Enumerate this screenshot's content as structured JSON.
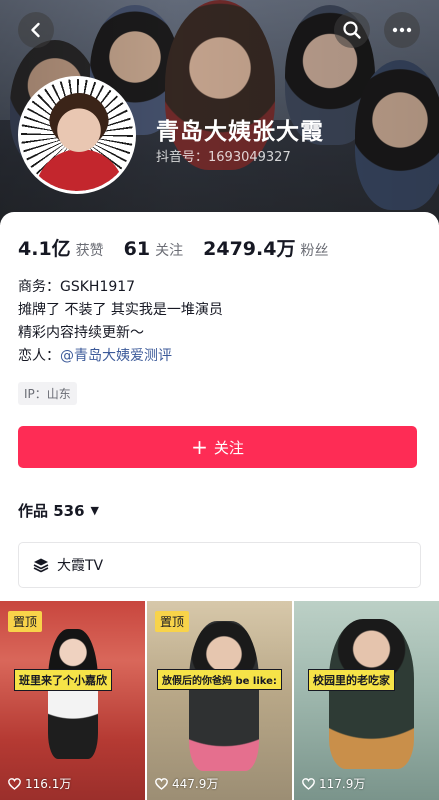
{
  "header": {
    "nickname": "青岛大姨张大霞",
    "douyin_id": "抖音号：1693049327"
  },
  "stats": [
    {
      "number": "4.1亿",
      "label": "获赞"
    },
    {
      "number": "61",
      "label": "关注"
    },
    {
      "number": "2479.4万",
      "label": "粉丝"
    }
  ],
  "bio": {
    "business": "商务：GSKH1917",
    "line1": "摊牌了 不装了 其实我是一堆演员",
    "line2": "精彩内容持续更新～",
    "partner_prefix": "恋人：",
    "partner_link": "@青岛大姨爱测评"
  },
  "ip": "IP：山东",
  "follow_button": {
    "plus": "+",
    "label": "关注"
  },
  "works": {
    "label": "作品 536",
    "caret": "▼"
  },
  "playlist": {
    "label": "大霞TV"
  },
  "videos": [
    {
      "pinned": "置顶",
      "caption": "班里来了个小嘉欣",
      "likes": "116.1万"
    },
    {
      "pinned": "置顶",
      "caption": "放假后的你爸妈 be like:",
      "likes": "447.9万"
    },
    {
      "pinned": "",
      "caption": "校园里的老吃家",
      "likes": "117.9万"
    }
  ],
  "icons": {
    "back": "chevron-left-icon",
    "search": "search-icon",
    "more": "more-dots-icon",
    "heart": "heart-outline-icon",
    "playlist": "layers-icon"
  },
  "colors": {
    "accent": "#fe2c55",
    "link": "#3c5a99",
    "pin": "#f8d34a"
  }
}
